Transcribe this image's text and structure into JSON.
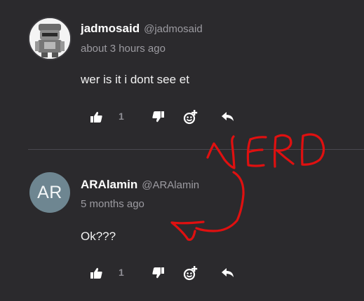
{
  "comments": [
    {
      "name": "jadmosaid",
      "handle": "@jadmosaid",
      "time": "about 3 hours ago",
      "text": "wer is it i dont see et",
      "likes": "1",
      "avatar_icon": "robot-avatar"
    },
    {
      "name": "ARAlamin",
      "handle": "@ARAlamin",
      "time": "5 months ago",
      "text": "Ok???",
      "likes": "1",
      "initials": "AR"
    }
  ],
  "actions": {
    "icons": [
      "thumbs-up-icon",
      "thumbs-down-icon",
      "add-reaction-icon",
      "reply-icon"
    ]
  },
  "overlay": {
    "scribble_text": "NERD",
    "color": "#e01010"
  },
  "colors": {
    "background": "#2b2a2d",
    "secondary_text": "#9c9ba1",
    "avatar_bg": "#6e8691"
  }
}
